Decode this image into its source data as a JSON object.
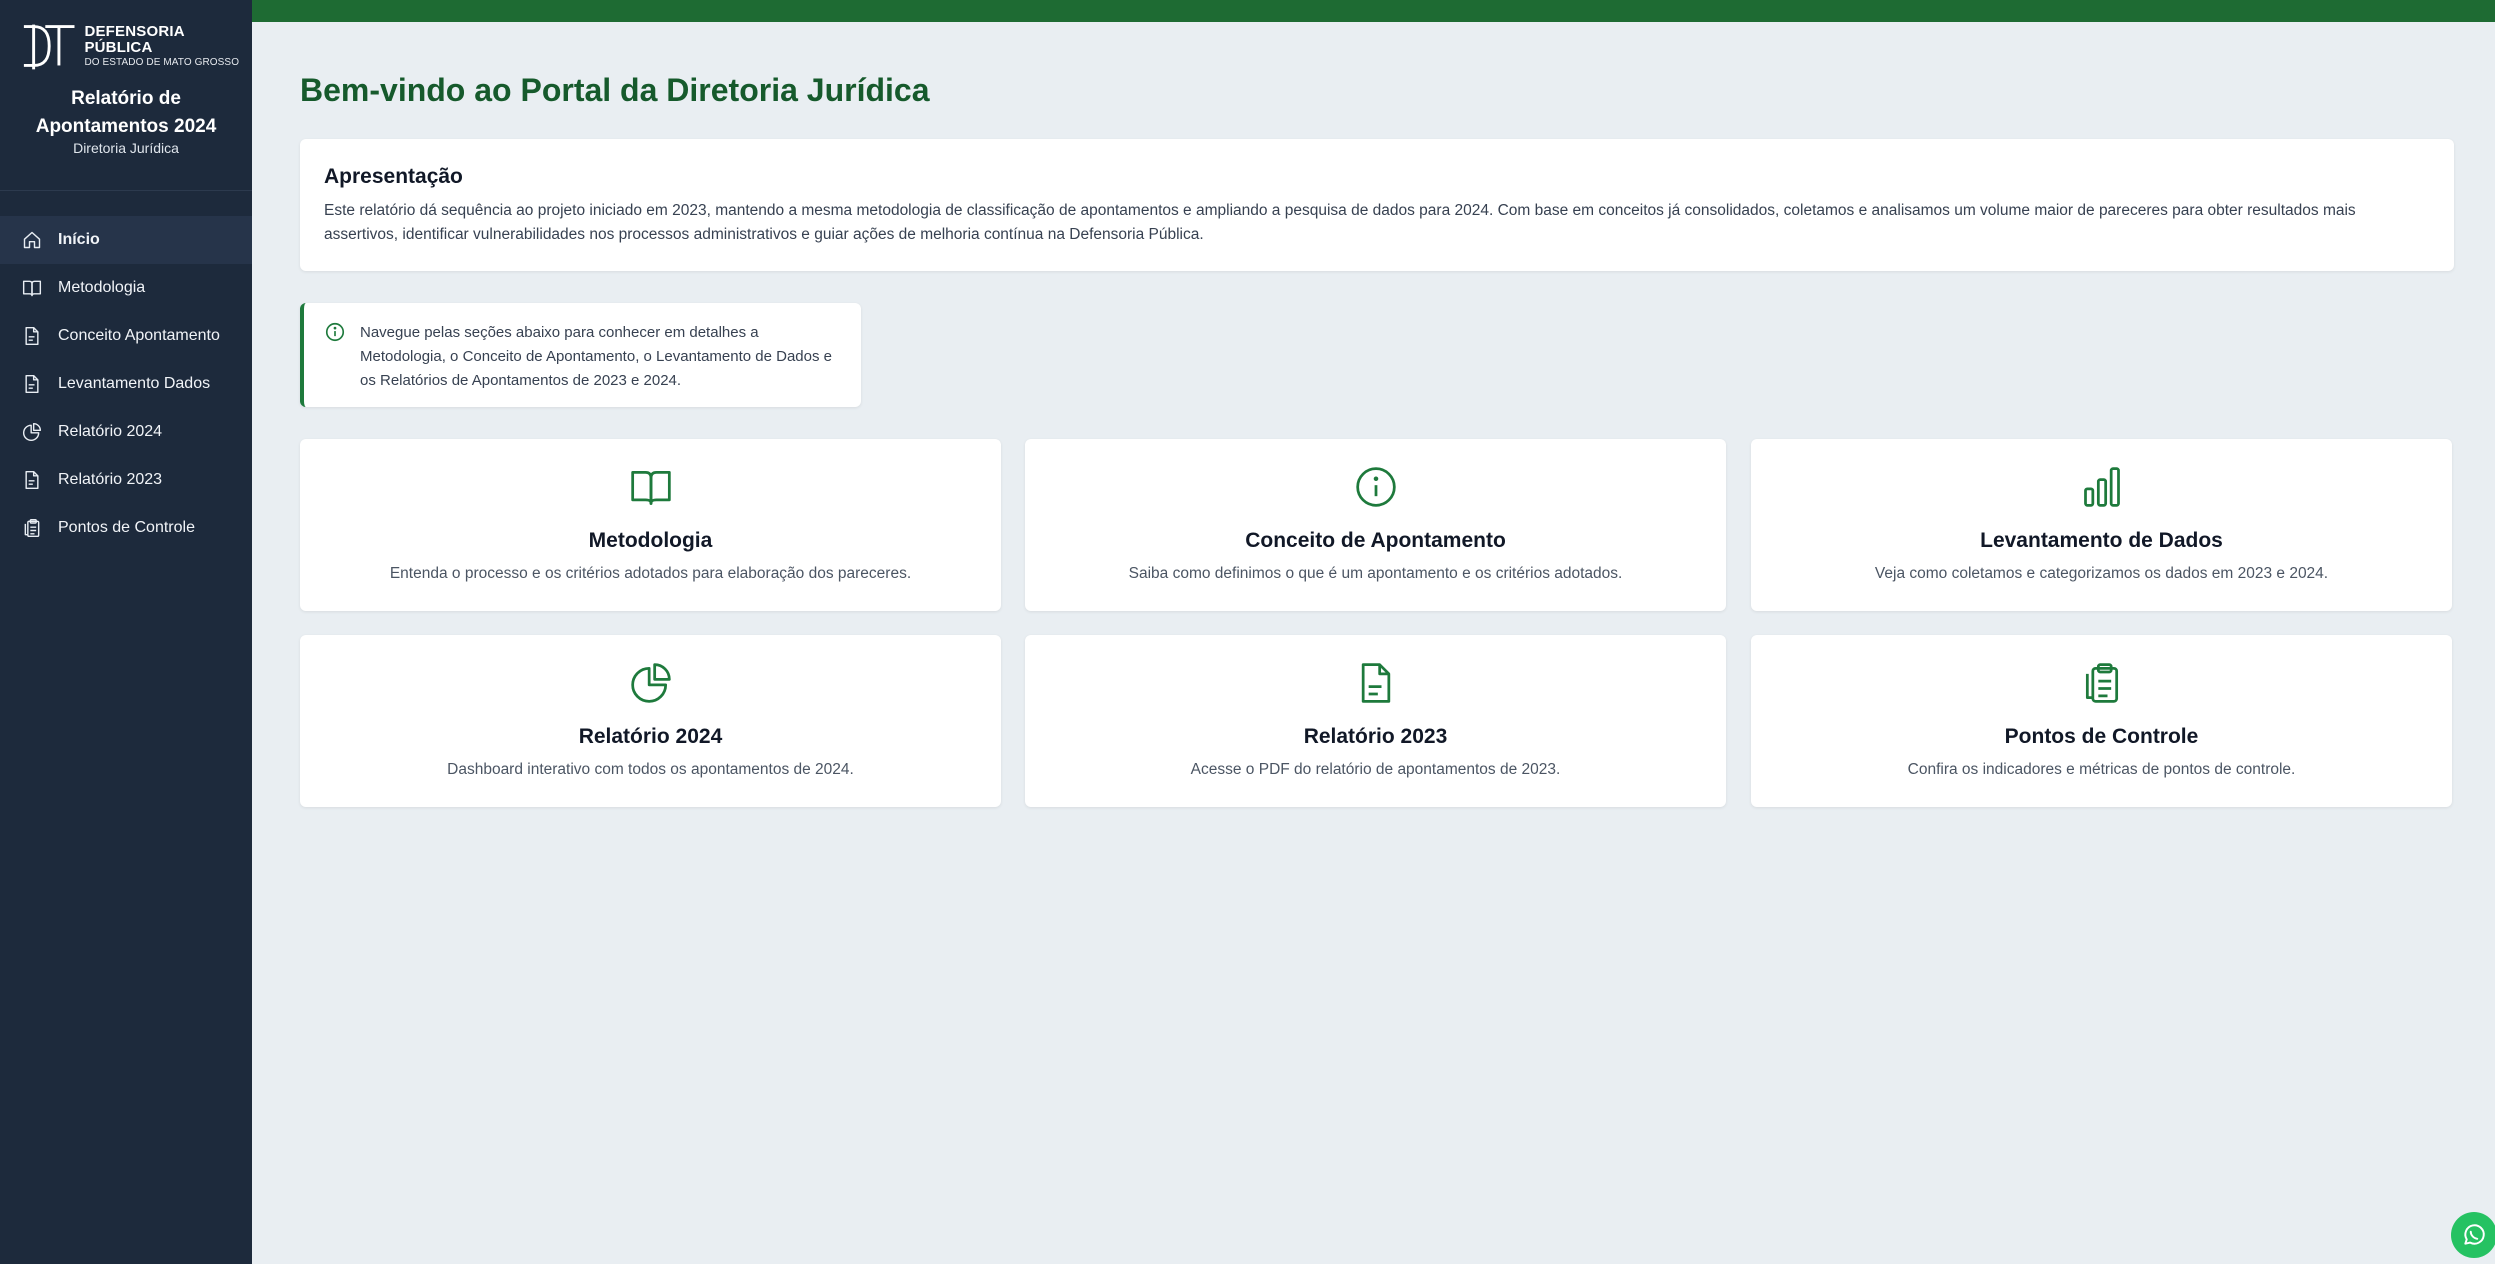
{
  "brand": {
    "logo_line1": "DEFENSORIA PÚBLICA",
    "logo_line2": "DO ESTADO DE MATO GROSSO",
    "title_line1": "Relatório de",
    "title_line2": "Apontamentos 2024",
    "subtitle": "Diretoria Jurídica"
  },
  "nav": [
    {
      "label": "Início",
      "icon": "home-icon",
      "active": true
    },
    {
      "label": "Metodologia",
      "icon": "book-icon"
    },
    {
      "label": "Conceito Apontamento",
      "icon": "document-icon"
    },
    {
      "label": "Levantamento Dados",
      "icon": "document-icon"
    },
    {
      "label": "Relatório 2024",
      "icon": "pie-chart-icon"
    },
    {
      "label": "Relatório 2023",
      "icon": "document-icon"
    },
    {
      "label": "Pontos de Controle",
      "icon": "clipboard-icon"
    }
  ],
  "main": {
    "title": "Bem-vindo ao Portal da Diretoria Jurídica",
    "intro": {
      "heading": "Apresentação",
      "text": "Este relatório dá sequência ao projeto iniciado em 2023, mantendo a mesma metodologia de classificação de apontamentos e ampliando a pesquisa de dados para 2024. Com base em conceitos já consolidados, coletamos e analisamos um volume maior de pareceres para obter resultados mais assertivos, identificar vulnerabilidades nos processos administrativos e guiar ações de melhoria contínua na Defensoria Pública."
    },
    "info": "Navegue pelas seções abaixo para conhecer em detalhes a Metodologia, o Conceito de Apontamento, o Levantamento de Dados e os Relatórios de Apontamentos de 2023 e 2024.",
    "tiles": [
      {
        "title": "Metodologia",
        "desc": "Entenda o processo e os critérios adotados para elaboração dos pareceres.",
        "icon": "book-icon"
      },
      {
        "title": "Conceito de Apontamento",
        "desc": "Saiba como definimos o que é um apontamento e os critérios adotados.",
        "icon": "info-icon"
      },
      {
        "title": "Levantamento de Dados",
        "desc": "Veja como coletamos e categorizamos os dados em 2023 e 2024.",
        "icon": "bar-chart-icon"
      },
      {
        "title": "Relatório 2024",
        "desc": "Dashboard interativo com todos os apontamentos de 2024.",
        "icon": "pie-chart-icon"
      },
      {
        "title": "Relatório 2023",
        "desc": "Acesse o PDF do relatório de apontamentos de 2023.",
        "icon": "document-icon"
      },
      {
        "title": "Pontos de Controle",
        "desc": "Confira os indicadores e métricas de pontos de controle.",
        "icon": "clipboard-icon"
      }
    ]
  },
  "colors": {
    "sidebar": "#1d2a3c",
    "accent": "#1e6b33",
    "title": "#165a2c",
    "whatsapp": "#25c262"
  }
}
